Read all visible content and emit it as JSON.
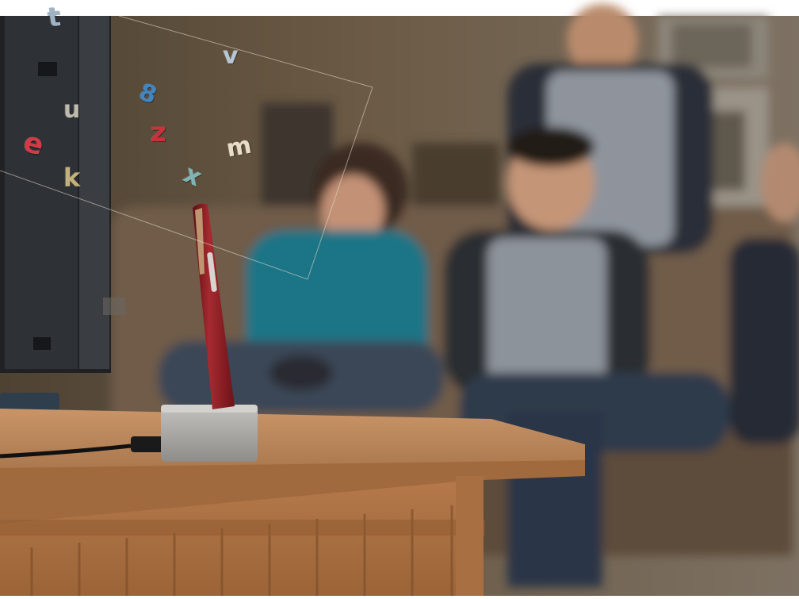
{
  "scene": {
    "description_free": true,
    "letters": [
      {
        "char": "t",
        "color": "#9fb3c4"
      },
      {
        "char": "v",
        "color": "#b8c6d2"
      },
      {
        "char": "u",
        "color": "#d9d2c2"
      },
      {
        "char": "8",
        "color": "#3f86c4"
      },
      {
        "char": "z",
        "color": "#c9323a"
      },
      {
        "char": "e",
        "color": "#d23a48"
      },
      {
        "char": "m",
        "color": "#e8ddc8"
      },
      {
        "char": "k",
        "color": "#e7d28f"
      },
      {
        "char": "x",
        "color": "#7fb3b7"
      }
    ],
    "colors": {
      "wall": "#5a4a38",
      "sofa": "#6e5c4a",
      "table": "#b9855a",
      "tv": "#2a2c30",
      "pen": "#8f1d22",
      "dock": "#b0aeab"
    }
  }
}
